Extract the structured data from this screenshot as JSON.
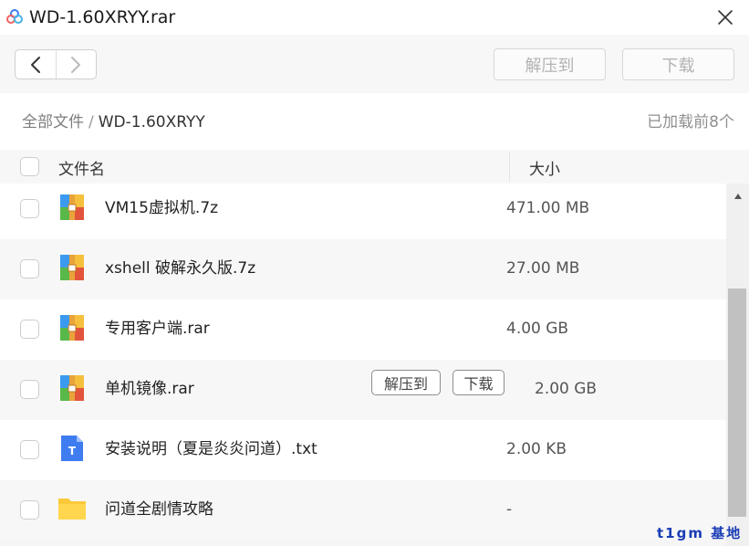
{
  "window": {
    "title": "WD-1.60XRYY.rar",
    "icon": "baidu-netdisk-cloud-icon",
    "close_icon": "close-icon"
  },
  "toolbar": {
    "back_icon": "chevron-left-icon",
    "forward_icon": "chevron-right-icon",
    "extract_label": "解压到",
    "download_label": "下载"
  },
  "breadcrumb": {
    "root": "全部文件",
    "separator": "/",
    "current": "WD-1.60XRYY",
    "loaded_info": "已加载前8个"
  },
  "columns": {
    "name": "文件名",
    "size": "大小"
  },
  "files": [
    {
      "name": "VM15虚拟机.7z",
      "size": "471.00 MB",
      "icon": "archive-icon"
    },
    {
      "name": "xshell 破解永久版.7z",
      "size": "27.00 MB",
      "icon": "archive-icon"
    },
    {
      "name": "专用客户端.rar",
      "size": "4.00 GB",
      "icon": "archive-icon"
    },
    {
      "name": "单机镜像.rar",
      "size": "2.00 GB",
      "icon": "archive-icon",
      "hovered": true,
      "extract_label": "解压到",
      "download_label": "下载"
    },
    {
      "name": "安装说明（夏是炎炎问道）.txt",
      "size": "2.00 KB",
      "icon": "text-file-icon",
      "icon_letter": "T"
    },
    {
      "name": "问道全剧情攻略",
      "size": "-",
      "icon": "folder-icon"
    }
  ],
  "watermark": "t1gm 基地",
  "colors": {
    "accent_blue": "#3e7cf0",
    "folder_yellow": "#f9c93a",
    "archive_red": "#e2543c",
    "archive_green": "#59b84a",
    "archive_blue": "#3b9af0",
    "archive_yellow": "#f6c03f"
  }
}
